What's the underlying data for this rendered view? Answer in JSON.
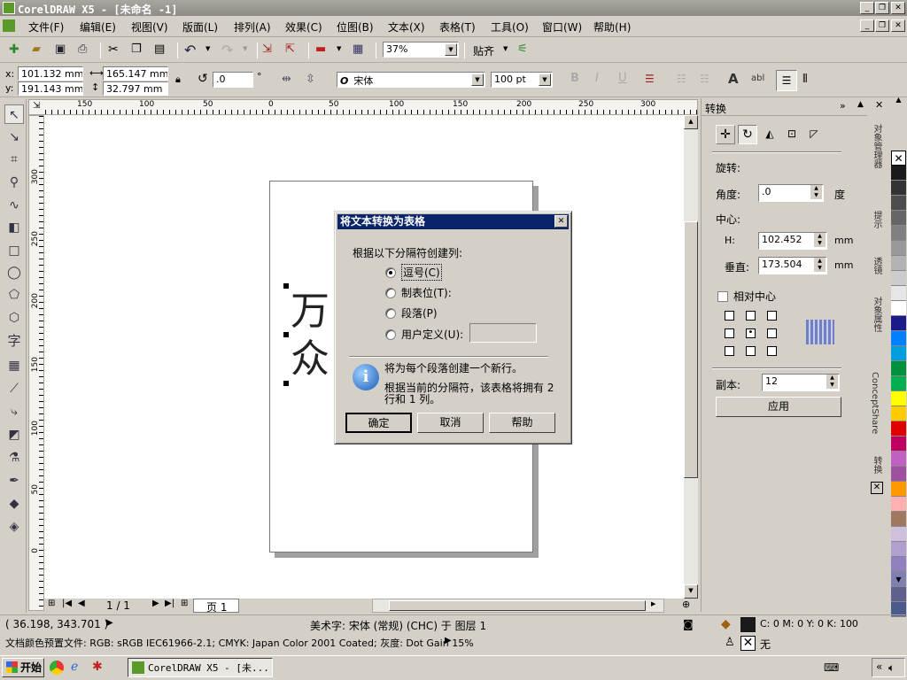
{
  "window": {
    "title": "CorelDRAW X5 - [未命名 -1]"
  },
  "menu": [
    "文件(F)",
    "编辑(E)",
    "视图(V)",
    "版面(L)",
    "排列(A)",
    "效果(C)",
    "位图(B)",
    "文本(X)",
    "表格(T)",
    "工具(O)",
    "窗口(W)",
    "帮助(H)"
  ],
  "standard_toolbar": {
    "zoom": "37%",
    "snap_label": "贴齐"
  },
  "property_bar": {
    "x": "101.132 mm",
    "y": "191.143 mm",
    "width": "165.147 mm",
    "height": "32.797 mm",
    "rotation": ".0",
    "degree_symbol": "°",
    "font": "宋体",
    "font_size": "100 pt",
    "bold": "B",
    "italic": "I",
    "underline": "U",
    "text_tool_a": "A",
    "text_tool_abl": "abl"
  },
  "ruler_top": [
    "150",
    "100",
    "50",
    "0",
    "50",
    "100",
    "150",
    "200",
    "250",
    "300"
  ],
  "ruler_left": [
    "300",
    "250",
    "200",
    "150",
    "100",
    "50",
    "0"
  ],
  "canvas_text": [
    "万",
    "众"
  ],
  "page_nav": {
    "current": "1 / 1",
    "tab": "页 1"
  },
  "dialog": {
    "title": "将文本转换为表格",
    "prompt": "根据以下分隔符创建列:",
    "options": [
      {
        "label": "逗号(C)",
        "selected": true
      },
      {
        "label": "制表位(T):",
        "selected": false
      },
      {
        "label": "段落(P)",
        "selected": false
      },
      {
        "label": "用户定义(U):",
        "selected": false
      }
    ],
    "info1": "将为每个段落创建一个新行。",
    "info2": "根据当前的分隔符，该表格将拥有 2 行和 1 列。",
    "ok": "确定",
    "cancel": "取消",
    "help": "帮助"
  },
  "docker": {
    "title": "转换",
    "section": "旋转:",
    "angle_label": "角度:",
    "angle": ".0",
    "angle_unit": "度",
    "center_label": "中心:",
    "h_label": "H:",
    "h": "102.452",
    "h_unit": "mm",
    "v_label": "垂直:",
    "v": "173.504",
    "v_unit": "mm",
    "relative_center": "相对中心",
    "copies_label": "副本:",
    "copies": "12",
    "apply": "应用"
  },
  "side_tabs": [
    "对象管理器",
    "提示",
    "透镜",
    "对象属性",
    "ConceptShare",
    "转换"
  ],
  "palette": [
    "#ffffff",
    "#1a1a1a",
    "#333333",
    "#4d4d4d",
    "#666666",
    "#808080",
    "#999999",
    "#b3b3b3",
    "#cccccc",
    "#e6e6e6",
    "#ffffff",
    "#1a1a8c",
    "#0080ff",
    "#00a0e0",
    "#009040",
    "#00b050",
    "#ffff00",
    "#ffcc00",
    "#e00000",
    "#c00060",
    "#c060c0",
    "#a050a0",
    "#ff9900",
    "#ffb0b0",
    "#a07860",
    "#d0c0e0",
    "#b0a0d0",
    "#9080c0",
    "#8080b0",
    "#606090",
    "#4a5a8a"
  ],
  "status": {
    "coords": "( 36.198, 343.701 )",
    "object": "美术字: 宋体 (常规) (CHC) 于 图层 1",
    "fill": "C: 0 M: 0 Y: 0 K: 100",
    "outline": "无",
    "color_profile": "文档颜色预置文件: RGB: sRGB IEC61966-2.1; CMYK: Japan Color 2001 Coated; 灰度: Dot Gain 15%"
  },
  "taskbar": {
    "start": "开始",
    "task": "CorelDRAW X5 - [未..."
  }
}
